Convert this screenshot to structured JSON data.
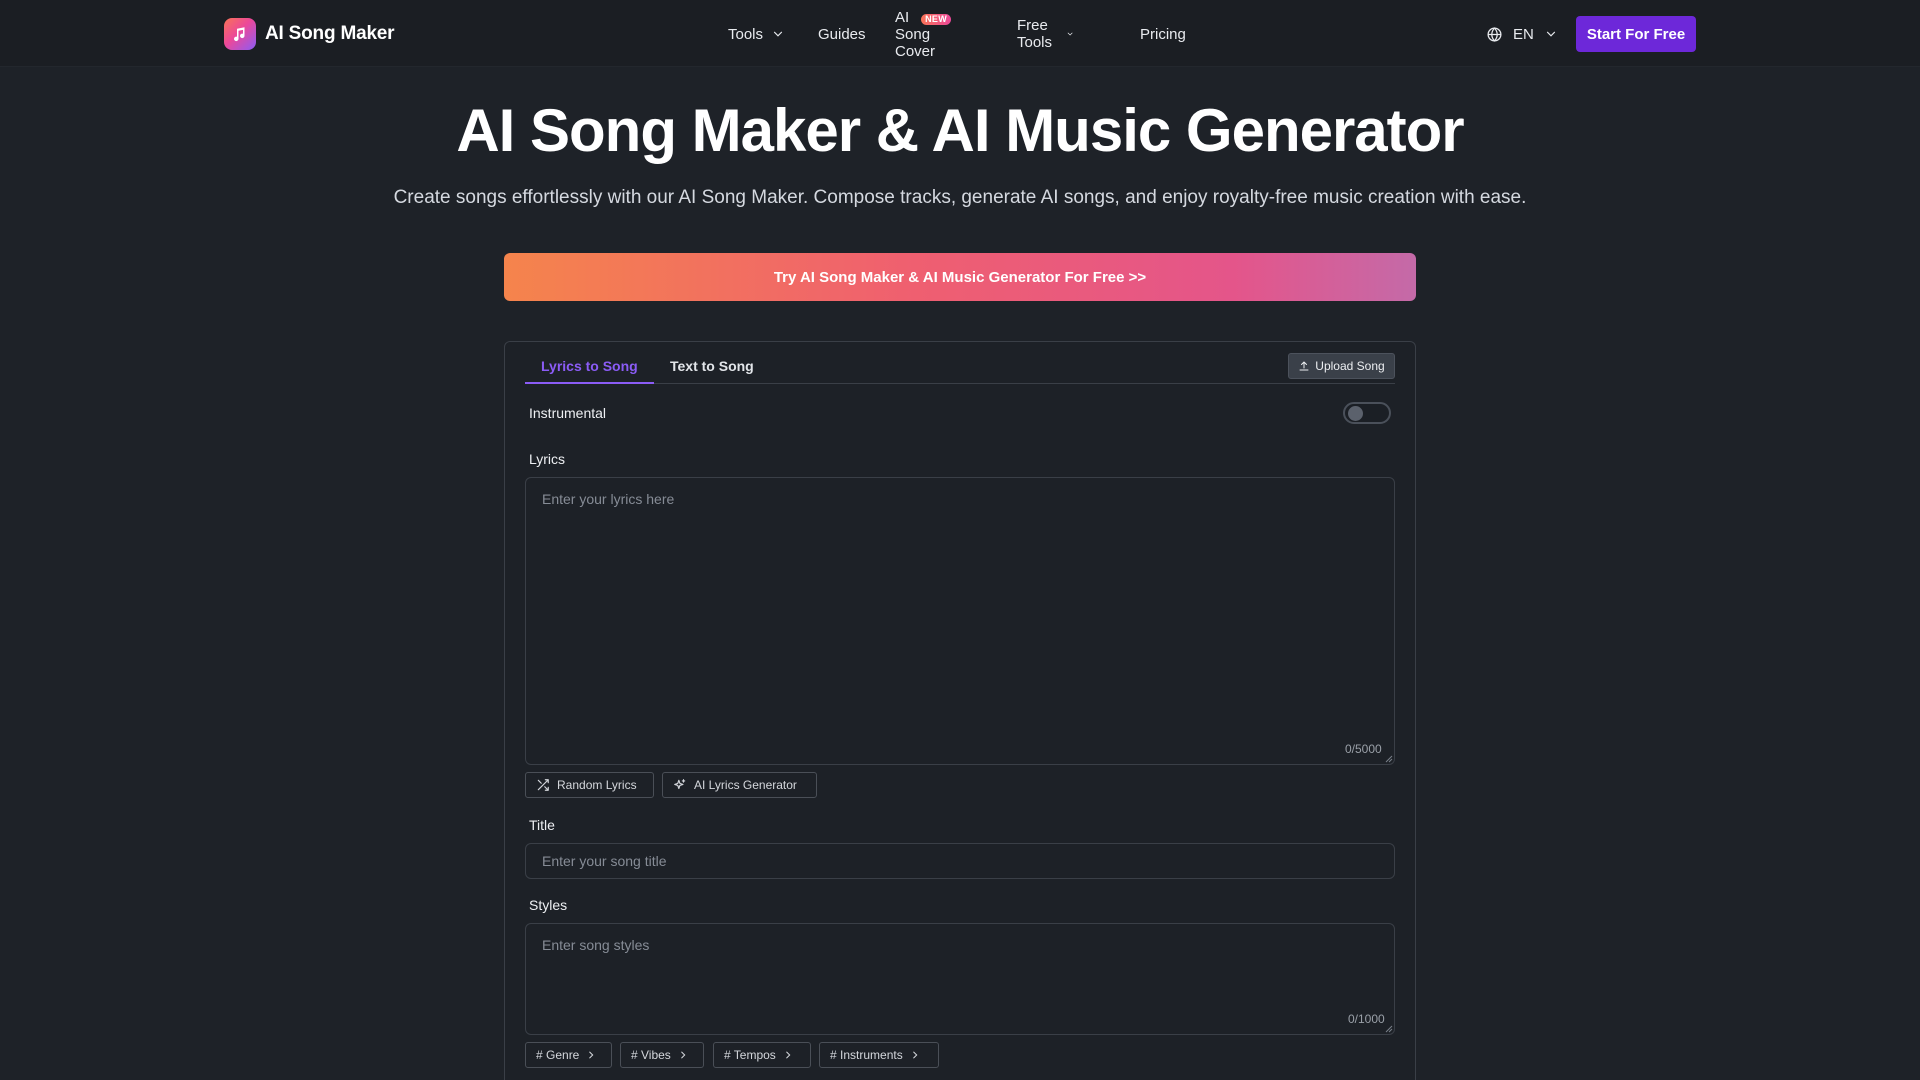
{
  "brand": {
    "name": "AI Song Maker",
    "logo_icon": "music-note-icon"
  },
  "nav": {
    "items": [
      {
        "label": "Tools",
        "has_dropdown": true
      },
      {
        "label": "Guides",
        "has_dropdown": false
      },
      {
        "label": "AI Song Cover",
        "has_dropdown": false,
        "badge": "NEW"
      },
      {
        "label": "Free Tools",
        "has_dropdown": true
      },
      {
        "label": "Pricing",
        "has_dropdown": false
      }
    ]
  },
  "header": {
    "language": "EN",
    "start_label": "Start For Free"
  },
  "hero": {
    "title": "AI Song Maker & AI Music Generator",
    "subtitle": "Create songs effortlessly with our AI Song Maker. Compose tracks, generate AI songs, and enjoy royalty-free music creation with ease.",
    "cta_label": "Try AI Song Maker & AI Music Generator For Free >>"
  },
  "panel": {
    "tabs": [
      {
        "label": "Lyrics to Song",
        "active": true
      },
      {
        "label": "Text to Song",
        "active": false
      }
    ],
    "upload_label": "Upload Song",
    "instrumental_label": "Instrumental",
    "instrumental_on": false,
    "lyrics": {
      "label": "Lyrics",
      "placeholder": "Enter your lyrics here",
      "counter": "0/5000"
    },
    "lyrics_actions": {
      "random_label": "Random Lyrics",
      "ai_generator_label": "AI Lyrics Generator"
    },
    "title_field": {
      "label": "Title",
      "placeholder": "Enter your song title"
    },
    "styles": {
      "label": "Styles",
      "placeholder": "Enter song styles",
      "counter": "0/1000",
      "tags": [
        "# Genre",
        "# Vibes",
        "# Tempos",
        "# Instruments"
      ]
    }
  },
  "colors": {
    "background": "#1e2228",
    "accent": "#6d28d9",
    "tab_active": "#8b5cf6",
    "cta_gradient_start": "#f5844c",
    "cta_gradient_end": "#c46aa8"
  }
}
